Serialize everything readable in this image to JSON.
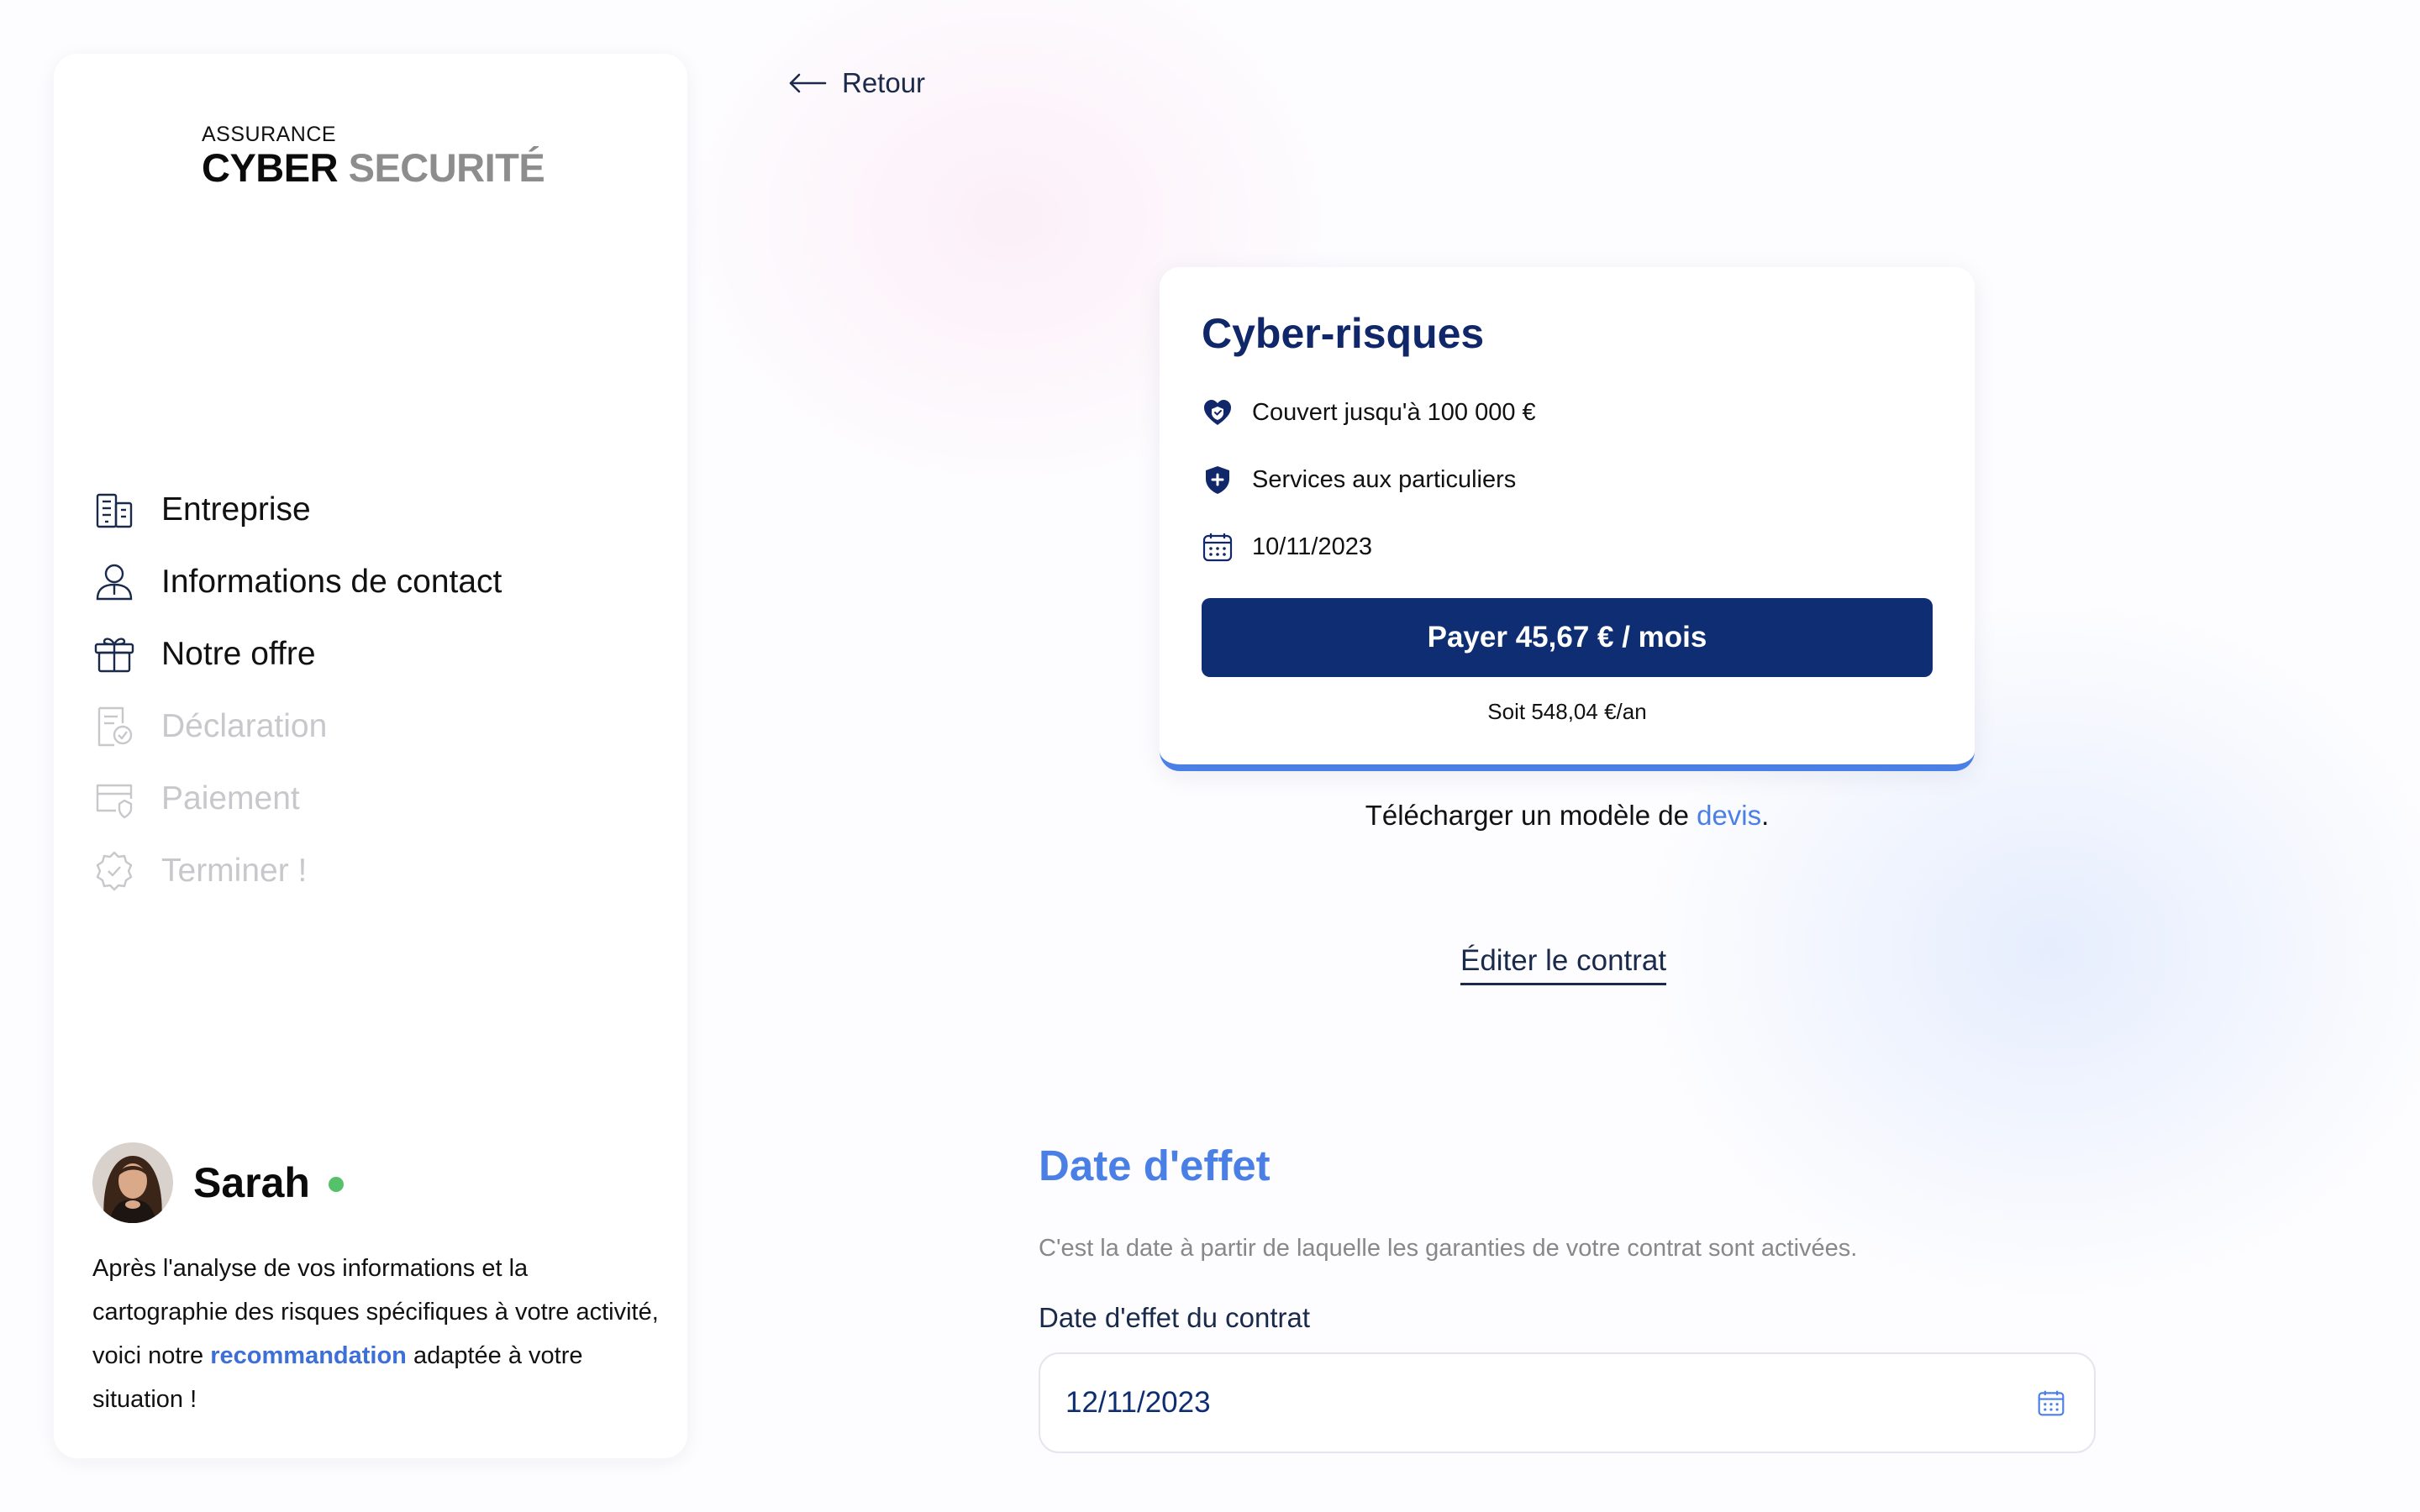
{
  "logo": {
    "small": "ASSURANCE",
    "cyber": "CYBER",
    "security": "SECURITÉ"
  },
  "nav": {
    "items": [
      {
        "label": "Entreprise",
        "icon": "building-icon",
        "enabled": true
      },
      {
        "label": "Informations de contact",
        "icon": "user-icon",
        "enabled": true
      },
      {
        "label": "Notre offre",
        "icon": "gift-icon",
        "enabled": true
      },
      {
        "label": "Déclaration",
        "icon": "document-check-icon",
        "enabled": false
      },
      {
        "label": "Paiement",
        "icon": "card-check-icon",
        "enabled": false
      },
      {
        "label": "Terminer !",
        "icon": "badge-check-icon",
        "enabled": false
      }
    ]
  },
  "advisor": {
    "name": "Sarah",
    "text_before": "Après l'analyse de vos informations et la cartographie des risques spécifiques à votre activité, voici notre ",
    "highlight": "recommandation",
    "text_after": " adaptée à votre situation !"
  },
  "back": {
    "label": "Retour"
  },
  "offer": {
    "title": "Cyber-risques",
    "features": [
      {
        "icon": "heart-shield-icon",
        "text": "Couvert jusqu'à 100 000 €"
      },
      {
        "icon": "shield-plus-icon",
        "text": "Services aux particuliers"
      },
      {
        "icon": "calendar-icon",
        "text": "10/11/2023"
      }
    ],
    "pay_button": "Payer 45,67 € / mois",
    "yearly": "Soit 548,04 €/an"
  },
  "download": {
    "text": "Télécharger un modèle de ",
    "link": "devis",
    "end": "."
  },
  "edit_contract": "Éditer le contrat",
  "effective_date": {
    "title": "Date d'effet",
    "description": "C'est la date à partir de laquelle les garanties de votre contrat sont activées.",
    "field_label": "Date d'effet du contrat",
    "value": "12/11/2023"
  },
  "colors": {
    "primary": "#0e2d72",
    "accent": "#4a7fe6",
    "online": "#55c16b",
    "disabled": "#c8c8cc"
  }
}
